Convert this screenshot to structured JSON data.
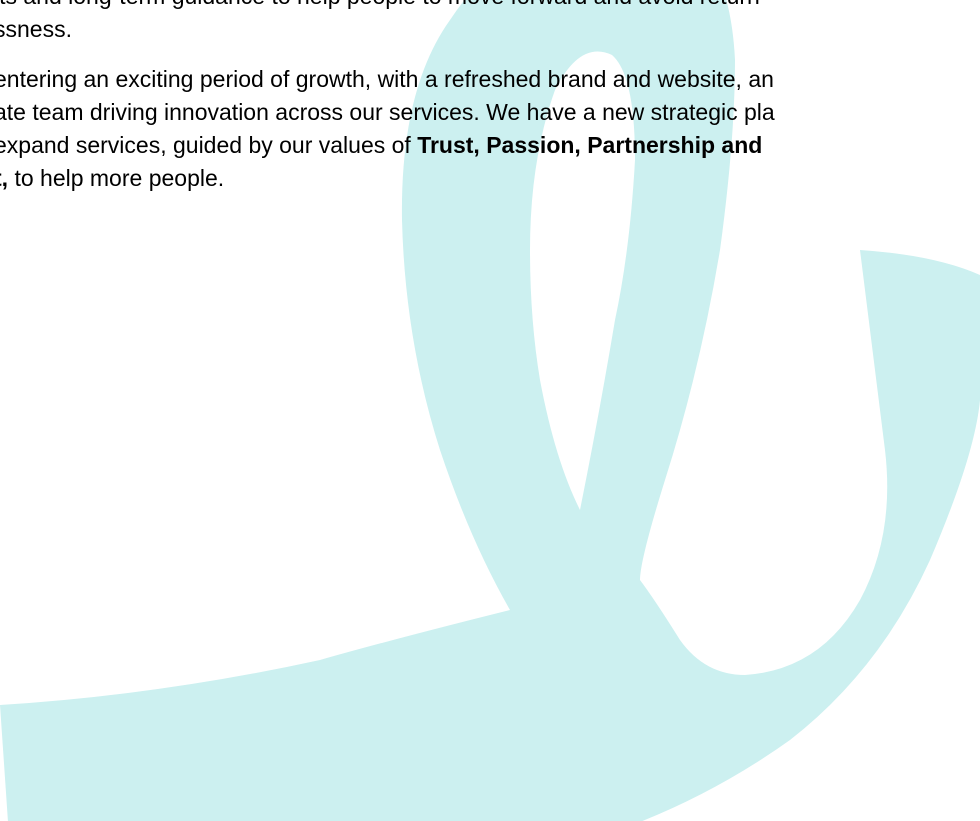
{
  "brand": {
    "ribbon_color": "#ccf0f0"
  },
  "document": {
    "paragraph_1": {
      "line_1": "its and long-term guidance to help people to move forward and avoid return",
      "line_2": "ssness."
    },
    "paragraph_2": {
      "line_1": "entering an exciting period of growth, with a refreshed brand and website, an",
      "line_2": "ate team driving innovation across our services. We have a new strategic pla",
      "line_3_prefix": " expand services, guided by our values of ",
      "values_bold": "Trust, Passion, Partnership and",
      "line_4_bold": "t,",
      "line_4_suffix": " to help more people."
    }
  }
}
